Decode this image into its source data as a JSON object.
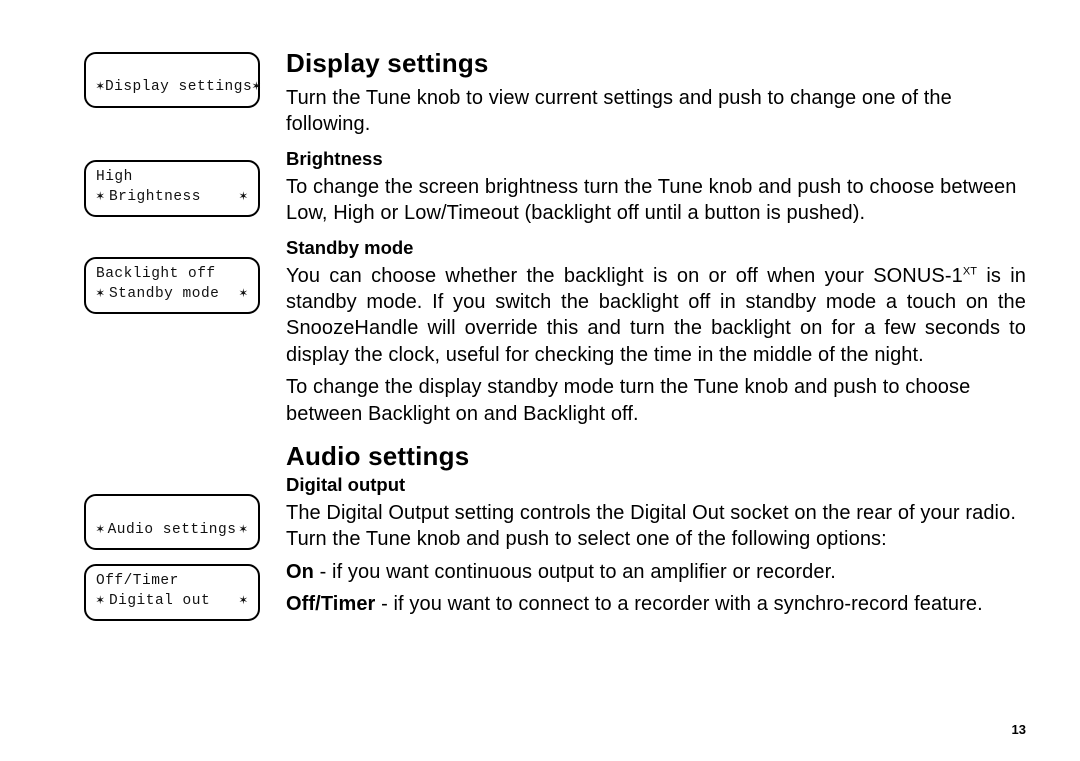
{
  "page_number": "13",
  "lcd": {
    "display_settings": {
      "center": "Display settings"
    },
    "brightness": {
      "top": "High",
      "bottom": "Brightness"
    },
    "standby": {
      "top": "Backlight off",
      "bottom": "Standby mode"
    },
    "audio_settings": {
      "center": "Audio settings"
    },
    "digital_out": {
      "top": "Off/Timer",
      "bottom": "Digital out"
    }
  },
  "section1": {
    "heading": "Display settings",
    "intro": "Turn the Tune knob to view current settings and push to change one of the following.",
    "brightness_h": "Brightness",
    "brightness_p": "To change the screen brightness turn the Tune knob and push to choose between Low, High or Low/Timeout (backlight off until a button is pushed).",
    "standby_h": "Standby mode",
    "standby_p_pre": "You can choose whether the backlight is on or off when your SONUS-1",
    "standby_p_sup": "XT",
    "standby_p_post": " is in standby mode. If you switch the backlight off in standby mode a touch on the SnoozeHandle will override this and turn the backlight on for a few seconds to display the clock, useful for checking the time in the middle of the night.",
    "standby_p2": "To change the display standby mode turn the Tune knob and push to choose between Backlight on and Backlight off."
  },
  "section2": {
    "heading": "Audio settings",
    "digital_h": "Digital output",
    "digital_p": "The Digital Output setting controls the Digital Out socket on the rear of your radio. Turn the Tune knob and push to select one of the following options:",
    "on_b": "On",
    "on_rest": " - if you want continuous output to an amplifier or recorder.",
    "off_b": "Off/Timer",
    "off_rest": " - if you want to connect to a recorder with a synchro-record feature."
  }
}
